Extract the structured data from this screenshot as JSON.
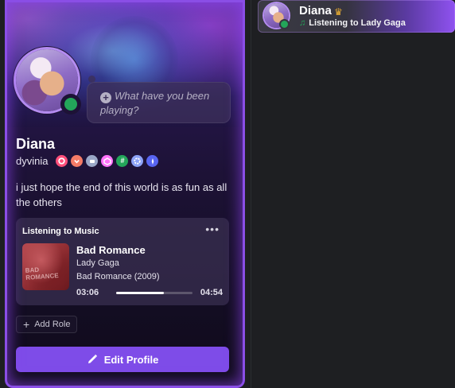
{
  "profile": {
    "display_name": "Diana",
    "username": "dyvinia",
    "bio": "i just hope the end of this world is as fun as all the others",
    "status_prompt": "What have you been playing?",
    "status_color": "#23a55a",
    "accent_color": "#8a4ee6",
    "badges": [
      {
        "icon": "nitro-icon",
        "color": "#ff4f7b"
      },
      {
        "icon": "heart-icon",
        "color": "#f47b67"
      },
      {
        "icon": "quest-icon",
        "color": "#9aa7c7"
      },
      {
        "icon": "boost-icon",
        "color": "#ff73fa"
      },
      {
        "icon": "hashtag-icon",
        "color": "#23a55a"
      },
      {
        "icon": "gear-icon",
        "color": "#8da2f7"
      },
      {
        "icon": "compass-icon",
        "color": "#5865f2"
      }
    ]
  },
  "music": {
    "header": "Listening to Music",
    "more": "•••",
    "title": "Bad Romance",
    "artist": "Lady Gaga",
    "album": "Bad Romance (2009)",
    "album_art_text": "BAD ROMANCE",
    "elapsed": "03:06",
    "duration": "04:54",
    "progress": 0.63
  },
  "actions": {
    "add_role": "Add Role",
    "edit_profile": "Edit Profile"
  },
  "member_list": {
    "name": "Diana",
    "activity": "Listening to Lady Gaga"
  }
}
